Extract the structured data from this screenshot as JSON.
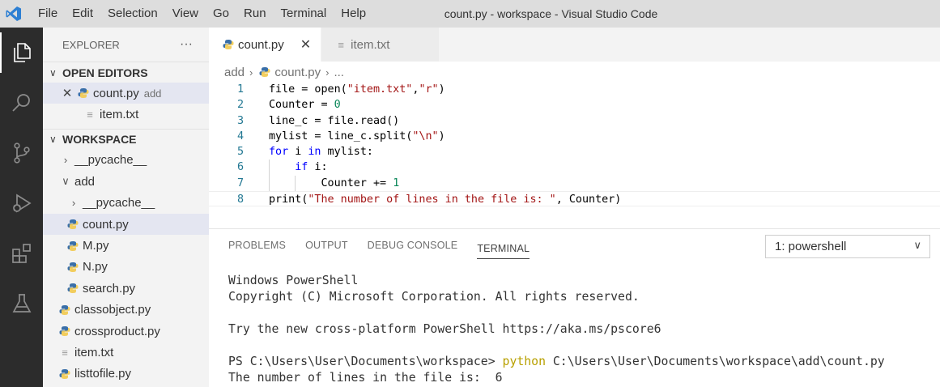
{
  "window": {
    "title": "count.py - workspace - Visual Studio Code"
  },
  "menu": [
    "File",
    "Edit",
    "Selection",
    "View",
    "Go",
    "Run",
    "Terminal",
    "Help"
  ],
  "activity": [
    "explorer-icon",
    "search-icon",
    "source-control-icon",
    "run-debug-icon",
    "extensions-icon",
    "testing-icon"
  ],
  "sidebar": {
    "title": "EXPLORER",
    "more": "···",
    "open_editors": {
      "label": "OPEN EDITORS",
      "items": [
        {
          "name": "count.py",
          "desc": "add"
        },
        {
          "name": "item.txt"
        }
      ]
    },
    "workspace": {
      "label": "WORKSPACE",
      "items": [
        {
          "name": "__pycache__"
        },
        {
          "name": "add"
        },
        {
          "name": "__pycache__"
        },
        {
          "name": "count.py"
        },
        {
          "name": "M.py"
        },
        {
          "name": "N.py"
        },
        {
          "name": "search.py"
        },
        {
          "name": "classobject.py"
        },
        {
          "name": "crossproduct.py"
        },
        {
          "name": "item.txt"
        },
        {
          "name": "listtofile.py"
        }
      ]
    }
  },
  "tabs": [
    {
      "label": "count.py",
      "close": "✕"
    },
    {
      "label": "item.txt"
    }
  ],
  "breadcrumb": {
    "folder": "add",
    "file": "count.py",
    "more": "..."
  },
  "code": {
    "line_numbers": [
      "1",
      "2",
      "3",
      "4",
      "5",
      "6",
      "7",
      "8"
    ],
    "l1": {
      "a": "file = open(",
      "s1": "\"item.txt\"",
      "b": ",",
      "s2": "\"r\"",
      "c": ")"
    },
    "l2": {
      "a": "Counter = ",
      "n": "0"
    },
    "l3": {
      "a": "line_c = file.read()"
    },
    "l4": {
      "a": "mylist = line_c.split(",
      "s": "\"\\n\"",
      "b": ")"
    },
    "l5": {
      "kw1": "for",
      "a": " i ",
      "kw2": "in",
      "b": " mylist:"
    },
    "l6": {
      "kw": "if",
      "a": " i:"
    },
    "l7": {
      "a": "Counter += ",
      "n": "1"
    },
    "l8": {
      "a": "print(",
      "s": "\"The number of lines in the file is: \"",
      "b": ", Counter)"
    }
  },
  "panel": {
    "tabs": [
      "PROBLEMS",
      "OUTPUT",
      "DEBUG CONSOLE",
      "TERMINAL"
    ],
    "shell": "1: powershell",
    "terminal": {
      "l1": "Windows PowerShell",
      "l2": "Copyright (C) Microsoft Corporation. All rights reserved.",
      "l3": "Try the new cross-platform PowerShell https://aka.ms/pscore6",
      "prompt": "PS C:\\Users\\User\\Documents\\workspace> ",
      "cmd": "python",
      "arg": " C:\\Users\\User\\Documents\\workspace\\add\\count.py",
      "output": "The number of lines in the file is:  6"
    }
  },
  "colors": {
    "keyword": "#0000ff",
    "string": "#a31515",
    "number": "#098658",
    "activitybar": "#2c2c2c",
    "python_blue": "#3a6fa8",
    "python_yellow": "#f2c94c"
  }
}
